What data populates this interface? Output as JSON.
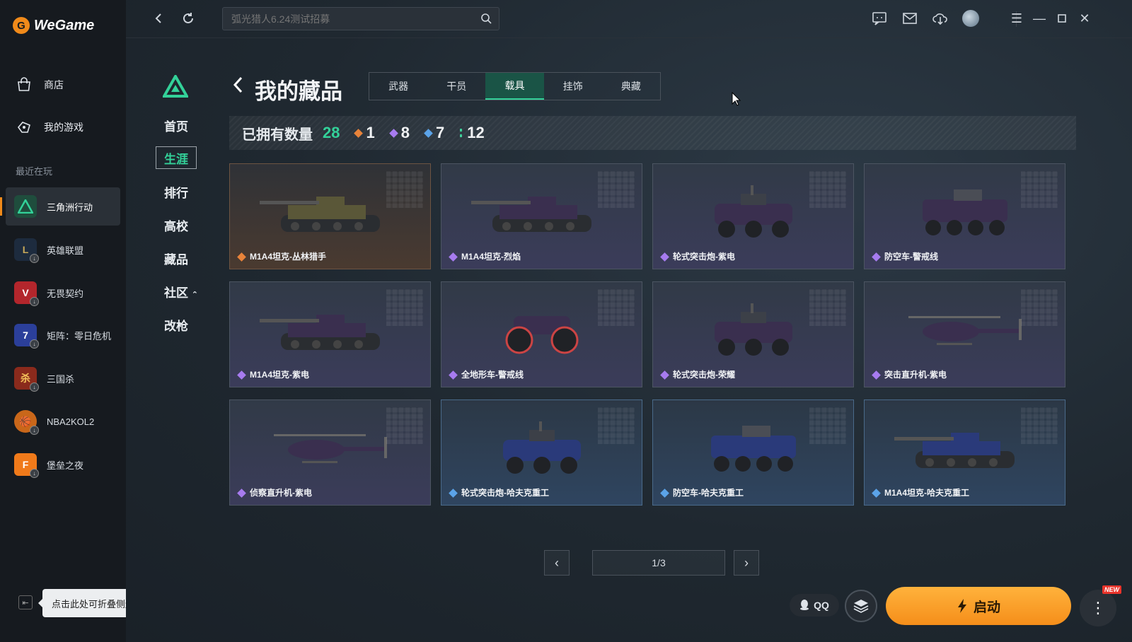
{
  "app": {
    "name": "WeGame"
  },
  "sidebar": {
    "items": [
      {
        "label": "商店",
        "icon": "store-bag-icon"
      },
      {
        "label": "我的游戏",
        "icon": "controller-icon"
      }
    ],
    "recent_label": "最近在玩",
    "games": [
      {
        "label": "三角洲行动",
        "color": "#1f4d3d"
      },
      {
        "label": "英雄联盟",
        "color": "#1d2b3e"
      },
      {
        "label": "无畏契约",
        "color": "#b3262c"
      },
      {
        "label": "矩阵：零日危机",
        "color": "#2b3f9a"
      },
      {
        "label": "三国杀",
        "color": "#8a2a1c"
      },
      {
        "label": "NBA2KOL2",
        "color": "#c9671a"
      },
      {
        "label": "堡垒之夜",
        "color": "#f07a1a"
      }
    ],
    "collapse_tooltip": "点击此处可折叠侧边栏"
  },
  "search": {
    "placeholder": "弧光猎人6.24测试招募"
  },
  "game_nav": [
    "首页",
    "生涯",
    "排行",
    "高校",
    "藏品",
    "社区",
    "改枪"
  ],
  "game_nav_active": "生涯",
  "collection": {
    "title": "我的藏品",
    "tabs": [
      "武器",
      "干员",
      "载具",
      "挂饰",
      "典藏"
    ],
    "active_tab": "载具",
    "owned_label": "已拥有数量",
    "owned_total": "28",
    "rarity_counts": [
      {
        "count": "1",
        "color": "#e8833a"
      },
      {
        "count": "8",
        "color": "#a77bf0"
      },
      {
        "count": "7",
        "color": "#5ba3e8"
      },
      {
        "count": "12",
        "color": "#3fcf9a"
      }
    ],
    "items": [
      {
        "name": "M1A4坦克-丛林猎手",
        "rarity": "gold",
        "kind": "tank"
      },
      {
        "name": "M1A4坦克-烈焰",
        "rarity": "purple",
        "kind": "tank"
      },
      {
        "name": "轮式突击炮-紫电",
        "rarity": "purple",
        "kind": "car"
      },
      {
        "name": "防空车-警戒线",
        "rarity": "purple",
        "kind": "apc"
      },
      {
        "name": "M1A4坦克-紫电",
        "rarity": "purple",
        "kind": "tank"
      },
      {
        "name": "全地形车-警戒线",
        "rarity": "purple",
        "kind": "atv"
      },
      {
        "name": "轮式突击炮-荣耀",
        "rarity": "purple",
        "kind": "car"
      },
      {
        "name": "突击直升机-紫电",
        "rarity": "purple",
        "kind": "heli"
      },
      {
        "name": "侦察直升机-紫电",
        "rarity": "purple",
        "kind": "heli"
      },
      {
        "name": "轮式突击炮-哈夫克重工",
        "rarity": "blue",
        "kind": "car"
      },
      {
        "name": "防空车-哈夫克重工",
        "rarity": "blue",
        "kind": "apc"
      },
      {
        "name": "M1A4坦克-哈夫克重工",
        "rarity": "blue",
        "kind": "tank"
      }
    ],
    "page": "1/3"
  },
  "footer": {
    "qq_label": "QQ",
    "launch_label": "启动",
    "new_badge": "NEW"
  }
}
